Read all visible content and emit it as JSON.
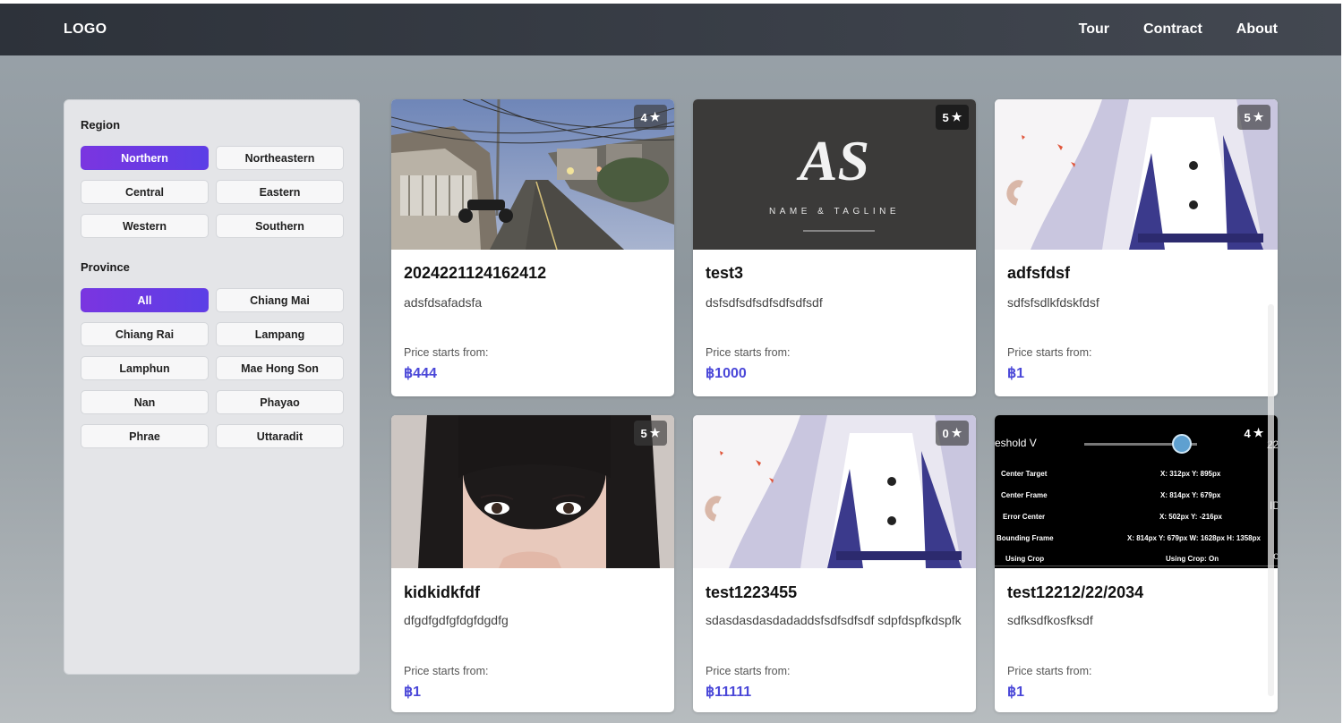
{
  "nav": {
    "logo": "LOGO",
    "links": [
      "Tour",
      "Contract",
      "About"
    ]
  },
  "filters": {
    "region_title": "Region",
    "regions": [
      "Northern",
      "Northeastern",
      "Central",
      "Eastern",
      "Western",
      "Southern"
    ],
    "region_selected": "Northern",
    "province_title": "Province",
    "provinces": [
      "All",
      "Chiang Mai",
      "Chiang Rai",
      "Lampang",
      "Lamphun",
      "Mae Hong Son",
      "Nan",
      "Phayao",
      "Phrae",
      "Uttaradit"
    ],
    "province_selected": "All"
  },
  "tours": [
    {
      "title": "2024221124162412",
      "desc": "adsfdsafadsfa",
      "price_label": "Price starts from:",
      "price": "฿444",
      "rating": "4",
      "image": "street-photo"
    },
    {
      "title": "test3",
      "desc": "dsfsdfsdfsdfsdfsdfsdf",
      "price_label": "Price starts from:",
      "price": "฿1000",
      "rating": "5",
      "image": "logo-placeholder",
      "image_text": {
        "mark": "AS",
        "tagline": "NAME & TAGLINE"
      }
    },
    {
      "title": "adfsfdsf",
      "desc": "sdfsfsdlkfdskfdsf",
      "price_label": "Price starts from:",
      "price": "฿1",
      "rating": "5",
      "image": "anime-character"
    },
    {
      "title": "kidkidkfdf",
      "desc": "dfgdfgdfgfdgfdgdfg",
      "price_label": "Price starts from:",
      "price": "฿1",
      "rating": "5",
      "image": "portrait-photo"
    },
    {
      "title": "test1223455",
      "desc": "sdasdasdasdadaddsfsdfsdfsdf sdpfdspfkdspfk",
      "price_label": "Price starts from:",
      "price": "฿11111",
      "rating": "0",
      "image": "anime-character"
    },
    {
      "title": "test12212/22/2034",
      "desc": "sdfksdfkosfksdf",
      "price_label": "Price starts from:",
      "price": "฿1",
      "rating": "4",
      "image": "debug-screenshot",
      "image_text": {
        "slider_label": "eshold V",
        "right_edge_1": "22",
        "right_edge_2": "ID",
        "right_edge_3": "o",
        "rows": [
          {
            "k": "Center Target",
            "v": "X: 312px Y: 895px"
          },
          {
            "k": "Center Frame",
            "v": "X: 814px Y: 679px"
          },
          {
            "k": "Error Center",
            "v": "X: 502px Y: -216px"
          },
          {
            "k": "Bounding Frame",
            "v": "X: 814px Y: 679px W: 1628px H: 1358px"
          },
          {
            "k": "Using Crop",
            "v": "Using Crop: On"
          }
        ]
      }
    }
  ],
  "star_glyph": "★",
  "colors": {
    "accent": "#5b3fe6",
    "price": "#4a47d8",
    "nav_bg": "#2d323a"
  }
}
